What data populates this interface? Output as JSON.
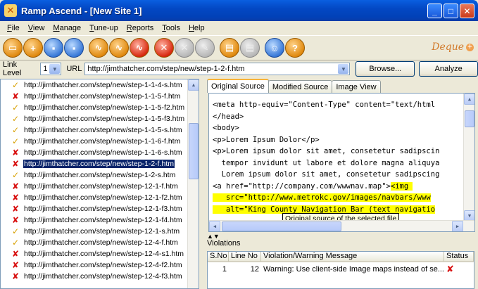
{
  "window": {
    "title": "Ramp Ascend - [New Site 1]"
  },
  "menu": [
    "File",
    "View",
    "Manage",
    "Tune-up",
    "Reports",
    "Tools",
    "Help"
  ],
  "brand": {
    "name": "Deque"
  },
  "urlbar": {
    "level_label": "Link Level",
    "level_value": "1",
    "url_label": "URL",
    "url_value": "http://jimthatcher.com/step/new/step-1-2-f.htm",
    "browse_label": "Browse...",
    "analyze_label": "Analyze"
  },
  "tree": [
    {
      "status": "pass",
      "url": "http://jimthatcher.com/step/new/step-1-1-4-s.htm"
    },
    {
      "status": "fail",
      "url": "http://jimthatcher.com/step/new/step-1-1-5-f.htm"
    },
    {
      "status": "pass",
      "url": "http://jimthatcher.com/step/new/step-1-1-5-f2.htm"
    },
    {
      "status": "pass",
      "url": "http://jimthatcher.com/step/new/step-1-1-5-f3.htm"
    },
    {
      "status": "pass",
      "url": "http://jimthatcher.com/step/new/step-1-1-5-s.htm"
    },
    {
      "status": "pass",
      "url": "http://jimthatcher.com/step/new/step-1-1-6-f.htm"
    },
    {
      "status": "fail",
      "url": "http://jimthatcher.com/step/new/step-1-1-6-s.htm"
    },
    {
      "status": "fail",
      "url": "http://jimthatcher.com/step/new/step-1-2-f.htm",
      "selected": true
    },
    {
      "status": "pass",
      "url": "http://jimthatcher.com/step/new/step-1-2-s.htm"
    },
    {
      "status": "fail",
      "url": "http://jimthatcher.com/step/new/step-12-1-f.htm"
    },
    {
      "status": "fail",
      "url": "http://jimthatcher.com/step/new/step-12-1-f2.htm"
    },
    {
      "status": "fail",
      "url": "http://jimthatcher.com/step/new/step-12-1-f3.htm"
    },
    {
      "status": "fail",
      "url": "http://jimthatcher.com/step/new/step-12-1-f4.htm"
    },
    {
      "status": "pass",
      "url": "http://jimthatcher.com/step/new/step-12-1-s.htm"
    },
    {
      "status": "pass",
      "url": "http://jimthatcher.com/step/new/step-12-4-f.htm"
    },
    {
      "status": "fail",
      "url": "http://jimthatcher.com/step/new/step-12-4-s1.htm"
    },
    {
      "status": "fail",
      "url": "http://jimthatcher.com/step/new/step-12-4-f2.htm"
    },
    {
      "status": "fail",
      "url": "http://jimthatcher.com/step/new/step-12-4-f3.htm"
    }
  ],
  "tabs": [
    "Original Source",
    "Modified Source",
    "Image View"
  ],
  "code_lines": [
    {
      "text": "<meta http-equiv=\"Content-Type\" content=\"text/html"
    },
    {
      "text": "</head>"
    },
    {
      "text": "<body>"
    },
    {
      "text": "<p>Lorem Ipsum Dolor</p>"
    },
    {
      "text": "<p>Lorem ipsum dolor sit amet, consetetur sadipscin"
    },
    {
      "text": "  tempor invidunt ut labore et dolore magna aliquya"
    },
    {
      "text": "  Lorem ipsum dolor sit amet, consetetur sadipscing"
    },
    {
      "pre": "<a href=\"http://company.com/wwwnav.map\">",
      "hl": "<img "
    },
    {
      "hl": "   src=\"http://www.metrokc.gov/images/navbars/www"
    },
    {
      "hl": "   alt=\"King County Navigation Bar (text navigatio"
    }
  ],
  "tooltip": "Original source of the selected file",
  "violations": {
    "title": "Violations",
    "columns": [
      "S.No",
      "Line No",
      "Violation/Warning Message",
      "Status"
    ],
    "rows": [
      {
        "sno": "1",
        "line": "12",
        "message": "Warning: Use client-side Image maps instead of se..."
      }
    ]
  },
  "colors": {
    "title_bar": "#0348c4",
    "selection": "#0a246a",
    "highlight": "#ffff00",
    "fail": "#d81010",
    "pass": "#d8a000"
  }
}
